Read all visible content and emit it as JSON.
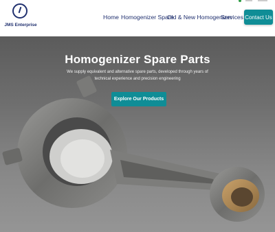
{
  "brand": {
    "name": "JMS Enterprise",
    "logo_icon": "gear-circle-icon"
  },
  "nav": {
    "items": [
      {
        "label": "Home"
      },
      {
        "label": "Homogenizer Spare"
      },
      {
        "label": "Old & New Homogenizer"
      },
      {
        "label": "Services"
      }
    ],
    "cta_label": "Contact Us"
  },
  "hero": {
    "title": "Homogenizer Spare Parts",
    "subtitle": "We supply equivalent and alternative spare parts, developed through years of technical experience and precision engineering",
    "cta_label": "Explore Our Products",
    "image": "connecting-rod-photo"
  },
  "colors": {
    "accent": "#0f8d96",
    "nav_text": "#1f2f6e"
  }
}
